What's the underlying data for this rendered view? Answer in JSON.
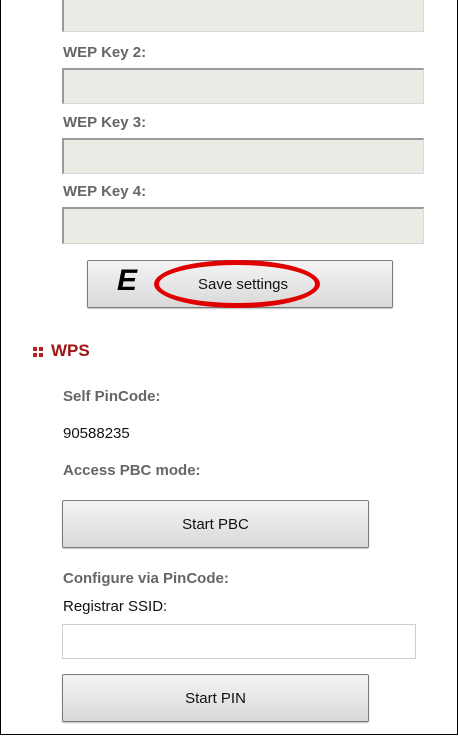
{
  "wep": {
    "key2_label": "WEP Key 2:",
    "key3_label": "WEP Key 3:",
    "key4_label": "WEP Key 4:",
    "key1_value": "",
    "key2_value": "",
    "key3_value": "",
    "key4_value": ""
  },
  "save_button_label": "Save settings",
  "annotation_letter": "E",
  "annotation_color": "#e00000",
  "wps": {
    "title": "WPS",
    "title_color": "#a01414",
    "self_pin_label": "Self PinCode:",
    "self_pin_value": "90588235",
    "pbc_label": "Access PBC mode:",
    "start_pbc_label": "Start PBC",
    "configure_label": "Configure via PinCode:",
    "registrar_label": "Registrar SSID:",
    "registrar_value": "",
    "start_pin_label": "Start PIN"
  }
}
